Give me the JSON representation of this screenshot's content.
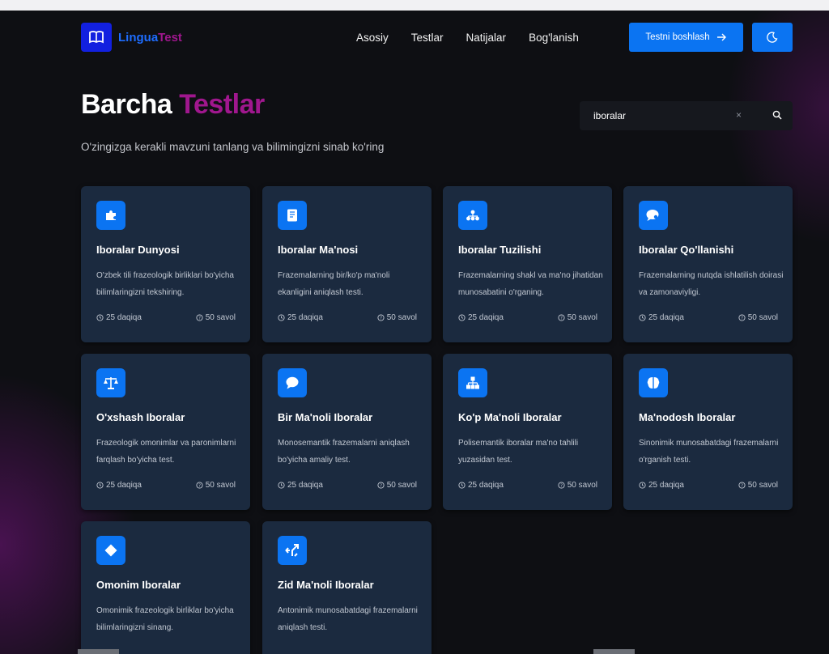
{
  "brand": {
    "name_part1": "Lingua",
    "name_part2": "Test"
  },
  "nav": {
    "links": [
      "Asosiy",
      "Testlar",
      "Natijalar",
      "Bog'lanish"
    ],
    "start_button": "Testni boshlash"
  },
  "page": {
    "title_part1": "Barcha",
    "title_part2": "Testlar",
    "subtitle": "O'zingizga kerakli mavzuni tanlang va bilimingizni sinab ko'ring"
  },
  "search": {
    "value": "iboralar",
    "placeholder": ""
  },
  "cards": [
    {
      "title": "Iboralar Dunyosi",
      "desc": "O'zbek tili frazeologik birliklari bo'yicha bilimlaringizni tekshiring.",
      "time": "25 daqiqa",
      "count": "50 savol",
      "icon": "puzzle-icon"
    },
    {
      "title": "Iboralar Ma'nosi",
      "desc": "Frazemalarning bir/ko'p ma'noli ekanligini aniqlash testi.",
      "time": "25 daqiqa",
      "count": "50 savol",
      "icon": "book-icon"
    },
    {
      "title": "Iboralar Tuzilishi",
      "desc": "Frazemalarning shakl va ma'no jihatidan munosabatini o'rganing.",
      "time": "25 daqiqa",
      "count": "50 savol",
      "icon": "structure-icon"
    },
    {
      "title": "Iboralar Qo'llanishi",
      "desc": "Frazemalarning nutqda ishlatilish doirasi va zamonaviyligi.",
      "time": "25 daqiqa",
      "count": "50 savol",
      "icon": "chat-users-icon"
    },
    {
      "title": "O'xshash Iboralar",
      "desc": "Frazeologik omonimlar va paronimlarni farqlash bo'yicha test.",
      "time": "25 daqiqa",
      "count": "50 savol",
      "icon": "scale-icon"
    },
    {
      "title": "Bir Ma'noli Iboralar",
      "desc": "Monosemantik frazemalarni aniqlash bo'yicha amaliy test.",
      "time": "25 daqiqa",
      "count": "50 savol",
      "icon": "speech-bubble-icon"
    },
    {
      "title": "Ko'p Ma'noli Iboralar",
      "desc": "Polisemantik iboralar ma'no tahlili yuzasidan test.",
      "time": "25 daqiqa",
      "count": "50 savol",
      "icon": "hierarchy-icon"
    },
    {
      "title": "Ma'nodosh Iboralar",
      "desc": "Sinonimik munosabatdagi frazemalarni o'rganish testi.",
      "time": "25 daqiqa",
      "count": "50 savol",
      "icon": "brain-icon"
    },
    {
      "title": "Omonim Iboralar",
      "desc": "Omonimik frazeologik birliklar bo'yicha bilimlaringizni sinang.",
      "time": "",
      "count": "",
      "icon": "diamond-icon"
    },
    {
      "title": "Zid Ma'noli Iboralar",
      "desc": "Antonimik munosabatdagi frazemalarni aniqlash testi.",
      "time": "",
      "count": "",
      "icon": "arrows-diverge-icon"
    }
  ],
  "colors": {
    "accent": "#0b74f2",
    "brand_purple": "#a0178e",
    "card_bg": "#1b2a3f",
    "page_bg": "#0e0f13"
  }
}
